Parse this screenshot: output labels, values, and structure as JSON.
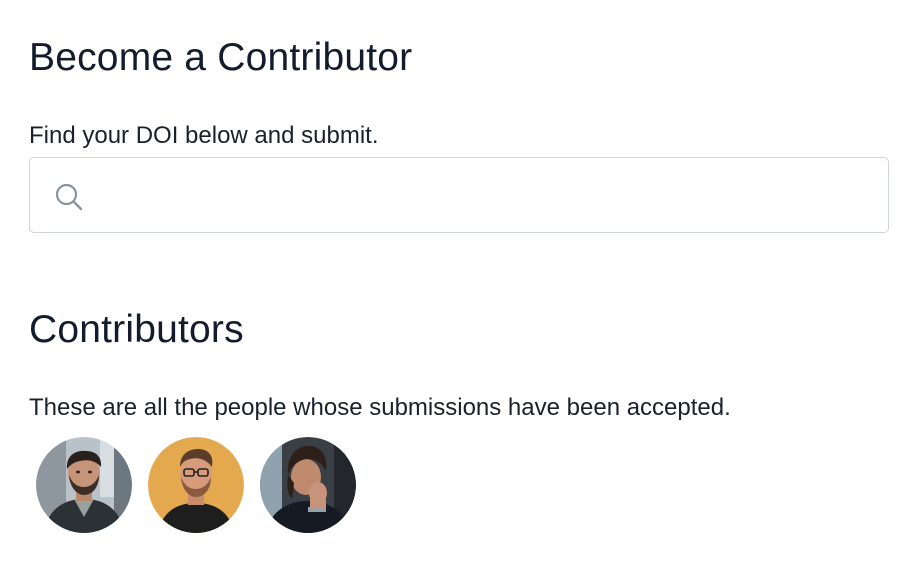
{
  "become_section": {
    "title": "Become a Contributor",
    "instructions": "Find your DOI below and submit.",
    "search": {
      "placeholder": "",
      "value": "",
      "icon": "search-icon"
    }
  },
  "contributors_section": {
    "title": "Contributors",
    "description": "These are all the people whose submissions have been accepted.",
    "avatars": [
      {
        "label": "contributor-1"
      },
      {
        "label": "contributor-2"
      },
      {
        "label": "contributor-3"
      }
    ]
  },
  "colors": {
    "text": "#141b2d",
    "border": "#cfd4da",
    "icon": "#8a929c"
  }
}
